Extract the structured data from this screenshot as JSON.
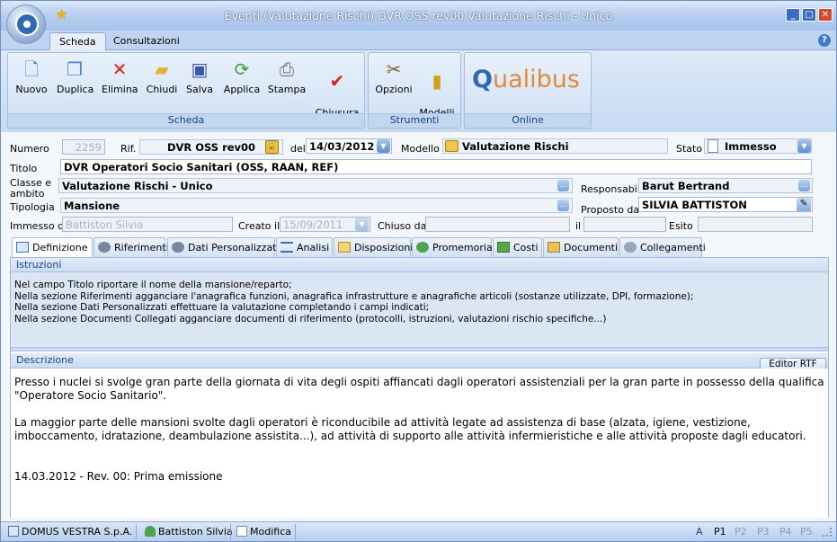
{
  "window": {
    "title": "Eventi (Valutazione Rischi)  DVR OSS rev00 Valutazione Rischi - Unico"
  },
  "ribbon_tabs": [
    "Scheda",
    "Consultazioni"
  ],
  "ribbon": {
    "groups": [
      {
        "label": "Scheda",
        "buttons": [
          {
            "label": "Nuovo",
            "icon": "new-document-icon"
          },
          {
            "label": "Duplica",
            "icon": "duplicate-icon"
          },
          {
            "label": "Elimina",
            "icon": "delete-x-icon"
          },
          {
            "label": "Chiudi",
            "icon": "close-folder-icon"
          },
          {
            "label": "Salva",
            "icon": "save-disk-icon"
          },
          {
            "label": "Applica",
            "icon": "apply-icon"
          },
          {
            "label": "Stampa",
            "icon": "printer-icon"
          },
          {
            "label": "Chiusura\nevento",
            "icon": "close-event-icon"
          }
        ]
      },
      {
        "label": "Strumenti",
        "buttons": [
          {
            "label": "Opzioni",
            "icon": "tools-icon"
          },
          {
            "label": "Modelli\nEventi",
            "icon": "books-icon"
          }
        ]
      },
      {
        "label": "Online",
        "logo": "Qualibus"
      }
    ]
  },
  "form": {
    "numero_label": "Numero",
    "numero": "2259",
    "rif_label": "Rif.",
    "rif": "DVR OSS rev00",
    "del_label": "del",
    "data": "14/03/2012",
    "modello_label": "Modello",
    "modello": "Valutazione Rischi",
    "stato_label": "Stato",
    "stato": "Immesso",
    "titolo_label": "Titolo",
    "titolo": "DVR Operatori Socio Sanitari (OSS, RAAN, REF)",
    "classe_label": "Classe e\nambito",
    "classe": "Valutazione Rischi - Unico",
    "responsabile_label": "Responsabile",
    "responsabile": "Barut Bertrand",
    "tipologia_label": "Tipologia",
    "tipologia": "Mansione",
    "proposto_label": "Proposto da",
    "proposto": "SILVIA BATTISTON",
    "immesso_label": "Immesso da",
    "immesso": "Battiston Silvia",
    "creato_label": "Creato il",
    "creato": "15/09/2011",
    "chiuso_label": "Chiuso da",
    "chiuso": "",
    "il_label": "il",
    "il": "",
    "esito_label": "Esito",
    "esito": ""
  },
  "tabs": [
    {
      "label": "Definizione",
      "icon": "definition-icon"
    },
    {
      "label": "Riferimenti",
      "icon": "references-icon"
    },
    {
      "label": "Dati Personalizzati",
      "icon": "custom-data-icon"
    },
    {
      "label": "Analisi",
      "icon": "analysis-list-icon"
    },
    {
      "label": "Disposizioni",
      "icon": "dispositions-icon"
    },
    {
      "label": "Promemoria",
      "icon": "reminder-icon"
    },
    {
      "label": "Costi",
      "icon": "costs-icon"
    },
    {
      "label": "Documenti",
      "icon": "documents-icon"
    },
    {
      "label": "Collegamenti",
      "icon": "links-gear-icon"
    }
  ],
  "istruzioni": {
    "header": "Istruzioni",
    "lines": [
      "Nel campo Titolo riportare il nome della mansione/reparto;",
      "Nella sezione Riferimenti agganciare l'anagrafica funzioni, anagrafica infrastrutture  e anagrafiche articoli (sostanze utilizzate, DPI, formazione);",
      "Nella sezione Dati Personalizzati effettuare la valutazione completando i campi indicati;",
      "Nella sezione Documenti Collegati agganciare documenti di riferimento (protocolli, istruzioni, valutazioni rischio specifiche...)"
    ]
  },
  "descrizione": {
    "header": "Descrizione",
    "editor_button": "Editor RTF",
    "paragraphs": [
      "Presso i nuclei si svolge gran parte della giornata di vita degli ospiti affiancati dagli operatori assistenziali per la gran parte in possesso della qualifica \"Operatore Socio Sanitario\".",
      "La maggior parte delle mansioni svolte dagli operatori è riconducibile ad attività legate ad assistenza di base (alzata, igiene, vestizione, imboccamento, idratazione, deambulazione assistita...), ad attività di supporto alle attività infermieristiche e alle attività proposte dagli educatori.",
      "14.03.2012 - Rev. 00: Prima emissione"
    ]
  },
  "statusbar": {
    "company": "DOMUS VESTRA S.p.A.",
    "user": "Battiston Silvia",
    "mode": "Modifica",
    "flags": [
      "A",
      "P1",
      "P2",
      "P3",
      "P4",
      "P5"
    ]
  }
}
